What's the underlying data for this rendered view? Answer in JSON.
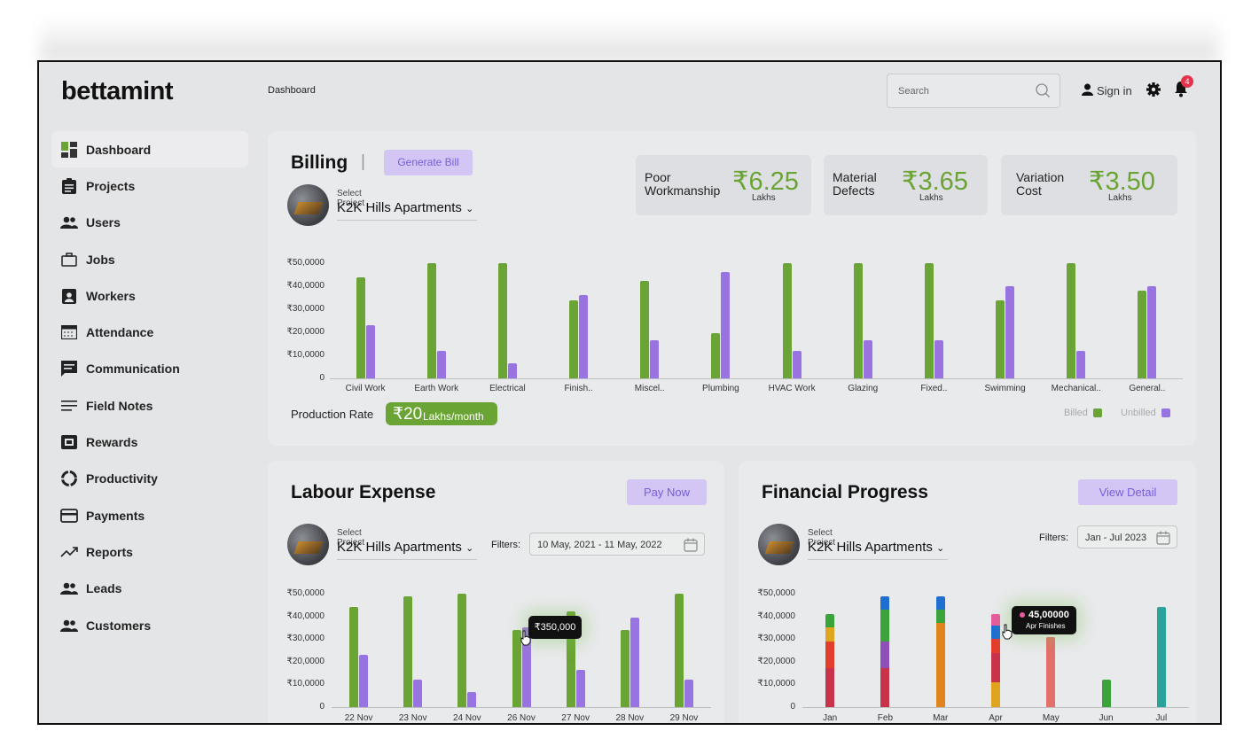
{
  "app": {
    "logo": "bettamint",
    "breadcrumb": "Dashboard",
    "search_placeholder": "Search",
    "signin": "Sign in",
    "notifications": "4"
  },
  "sidebar": {
    "items": [
      {
        "label": "Dashboard",
        "icon": "dashboard-icon",
        "active": true
      },
      {
        "label": "Projects",
        "icon": "clipboard-icon"
      },
      {
        "label": "Users",
        "icon": "users-icon"
      },
      {
        "label": "Jobs",
        "icon": "briefcase-icon"
      },
      {
        "label": "Workers",
        "icon": "id-badge-icon"
      },
      {
        "label": "Attendance",
        "icon": "calendar-icon"
      },
      {
        "label": "Communication",
        "icon": "chat-icon"
      },
      {
        "label": "Field Notes",
        "icon": "lines-icon"
      },
      {
        "label": "Rewards",
        "icon": "reward-icon"
      },
      {
        "label": "Productivity",
        "icon": "circle-progress-icon"
      },
      {
        "label": "Payments",
        "icon": "card-icon"
      },
      {
        "label": "Reports",
        "icon": "trend-icon"
      },
      {
        "label": "Leads",
        "icon": "users-icon"
      },
      {
        "label": "Customers",
        "icon": "users-icon"
      }
    ]
  },
  "billing": {
    "title": "Billing",
    "separator": "|",
    "generate_btn": "Generate Bill",
    "project_label": "Select Project",
    "project_value": "K2K Hills Apartments",
    "stats": [
      {
        "label1": "Poor",
        "label2": "Workmanship",
        "value": "₹6.25",
        "unit": "Lakhs"
      },
      {
        "label1": "Material",
        "label2": "Defects",
        "value": "₹3.65",
        "unit": "Lakhs"
      },
      {
        "label1": "Variation",
        "label2": "Cost",
        "value": "₹3.50",
        "unit": "Lakhs"
      }
    ],
    "production_rate_label": "Production Rate",
    "production_rate_value": "₹20",
    "production_rate_unit": "Lakhs/month",
    "legend_billed": "Billed",
    "legend_unbilled": "Unbilled"
  },
  "labour": {
    "title": "Labour Expense",
    "pay_btn": "Pay Now",
    "project_label": "Select Project",
    "project_value": "K2K Hills Apartments",
    "filters_label": "Filters:",
    "date_range": "10 May, 2021 - 11 May, 2022",
    "tooltip": "₹350,000"
  },
  "financial": {
    "title": "Financial Progress",
    "view_btn": "View Detail",
    "project_label": "Select Project",
    "project_value": "K2K Hills Apartments",
    "filters_label": "Filters:",
    "date_range": "Jan - Jul 2023",
    "tooltip_value": "45,00000",
    "tooltip_label": "Apr Finishes"
  },
  "colors": {
    "green": "#6aa434",
    "purple": "#9873e2",
    "accent_btn": "#d3c6f4"
  },
  "chart_data": [
    {
      "type": "bar",
      "title": "Billing",
      "yticks": [
        "₹50,0000",
        "₹40,0000",
        "₹30,0000",
        "₹20,0000",
        "₹10,0000",
        "0"
      ],
      "ylim": [
        0,
        500000
      ],
      "categories": [
        "Civil Work",
        "Earth Work",
        "Electrical",
        "Finish..",
        "Miscel..",
        "Plumbing",
        "HVAC Work",
        "Glazing",
        "Fixed..",
        "Swimming",
        "Mechanical..",
        "General.."
      ],
      "series": [
        {
          "name": "Billed",
          "values": [
            440000,
            500000,
            540000,
            340000,
            425000,
            195000,
            540000,
            540000,
            540000,
            340000,
            500000,
            380000
          ]
        },
        {
          "name": "Unbilled",
          "values": [
            230000,
            120000,
            65000,
            360000,
            165000,
            460000,
            120000,
            165000,
            165000,
            400000,
            120000,
            400000
          ]
        }
      ]
    },
    {
      "type": "bar",
      "title": "Labour Expense",
      "yticks": [
        "₹50,0000",
        "₹40,0000",
        "₹30,0000",
        "₹20,0000",
        "₹10,0000",
        "0"
      ],
      "ylim": [
        0,
        500000
      ],
      "categories": [
        "22 Nov",
        "23 Nov",
        "24 Nov",
        "26 Nov",
        "27 Nov",
        "28 Nov",
        "29 Nov"
      ],
      "series": [
        {
          "values": [
            440000,
            490000,
            530000,
            340000,
            420000,
            340000,
            530000
          ]
        },
        {
          "values": [
            230000,
            120000,
            65000,
            350000,
            165000,
            395000,
            120000
          ]
        }
      ]
    },
    {
      "type": "bar",
      "title": "Financial Progress",
      "yticks": [
        "₹50,0000",
        "₹40,0000",
        "₹30,0000",
        "₹20,0000",
        "₹10,0000",
        "0"
      ],
      "ylim": [
        0,
        500000
      ],
      "categories": [
        "Jan",
        "Feb",
        "Mar",
        "Apr",
        "May",
        "Jun",
        "Jul"
      ],
      "stacks": [
        [
          {
            "value": 170000,
            "color": "#c8334a"
          },
          {
            "value": 120000,
            "color": "#e33d2c"
          },
          {
            "value": 60000,
            "color": "#e0a51e"
          },
          {
            "value": 60000,
            "color": "#3aa43a"
          }
        ],
        [
          {
            "value": 170000,
            "color": "#c8334a"
          },
          {
            "value": 120000,
            "color": "#8e4fb8"
          },
          {
            "value": 140000,
            "color": "#3aa43a"
          },
          {
            "value": 60000,
            "color": "#1f6fd0"
          }
        ],
        [
          {
            "value": 370000,
            "color": "#e0841e"
          },
          {
            "value": 60000,
            "color": "#3aa43a"
          },
          {
            "value": 60000,
            "color": "#1f6fd0"
          }
        ],
        [
          {
            "value": 110000,
            "color": "#e0a51e"
          },
          {
            "value": 130000,
            "color": "#c8334a"
          },
          {
            "value": 60000,
            "color": "#e33d2c"
          },
          {
            "value": 60000,
            "color": "#1f6fd0"
          },
          {
            "value": 50000,
            "color": "#e85aa0"
          }
        ],
        [
          {
            "value": 310000,
            "color": "#e4706a"
          }
        ],
        [
          {
            "value": 120000,
            "color": "#3aa43a"
          }
        ],
        [
          {
            "value": 440000,
            "color": "#2aa39a"
          }
        ]
      ]
    }
  ]
}
